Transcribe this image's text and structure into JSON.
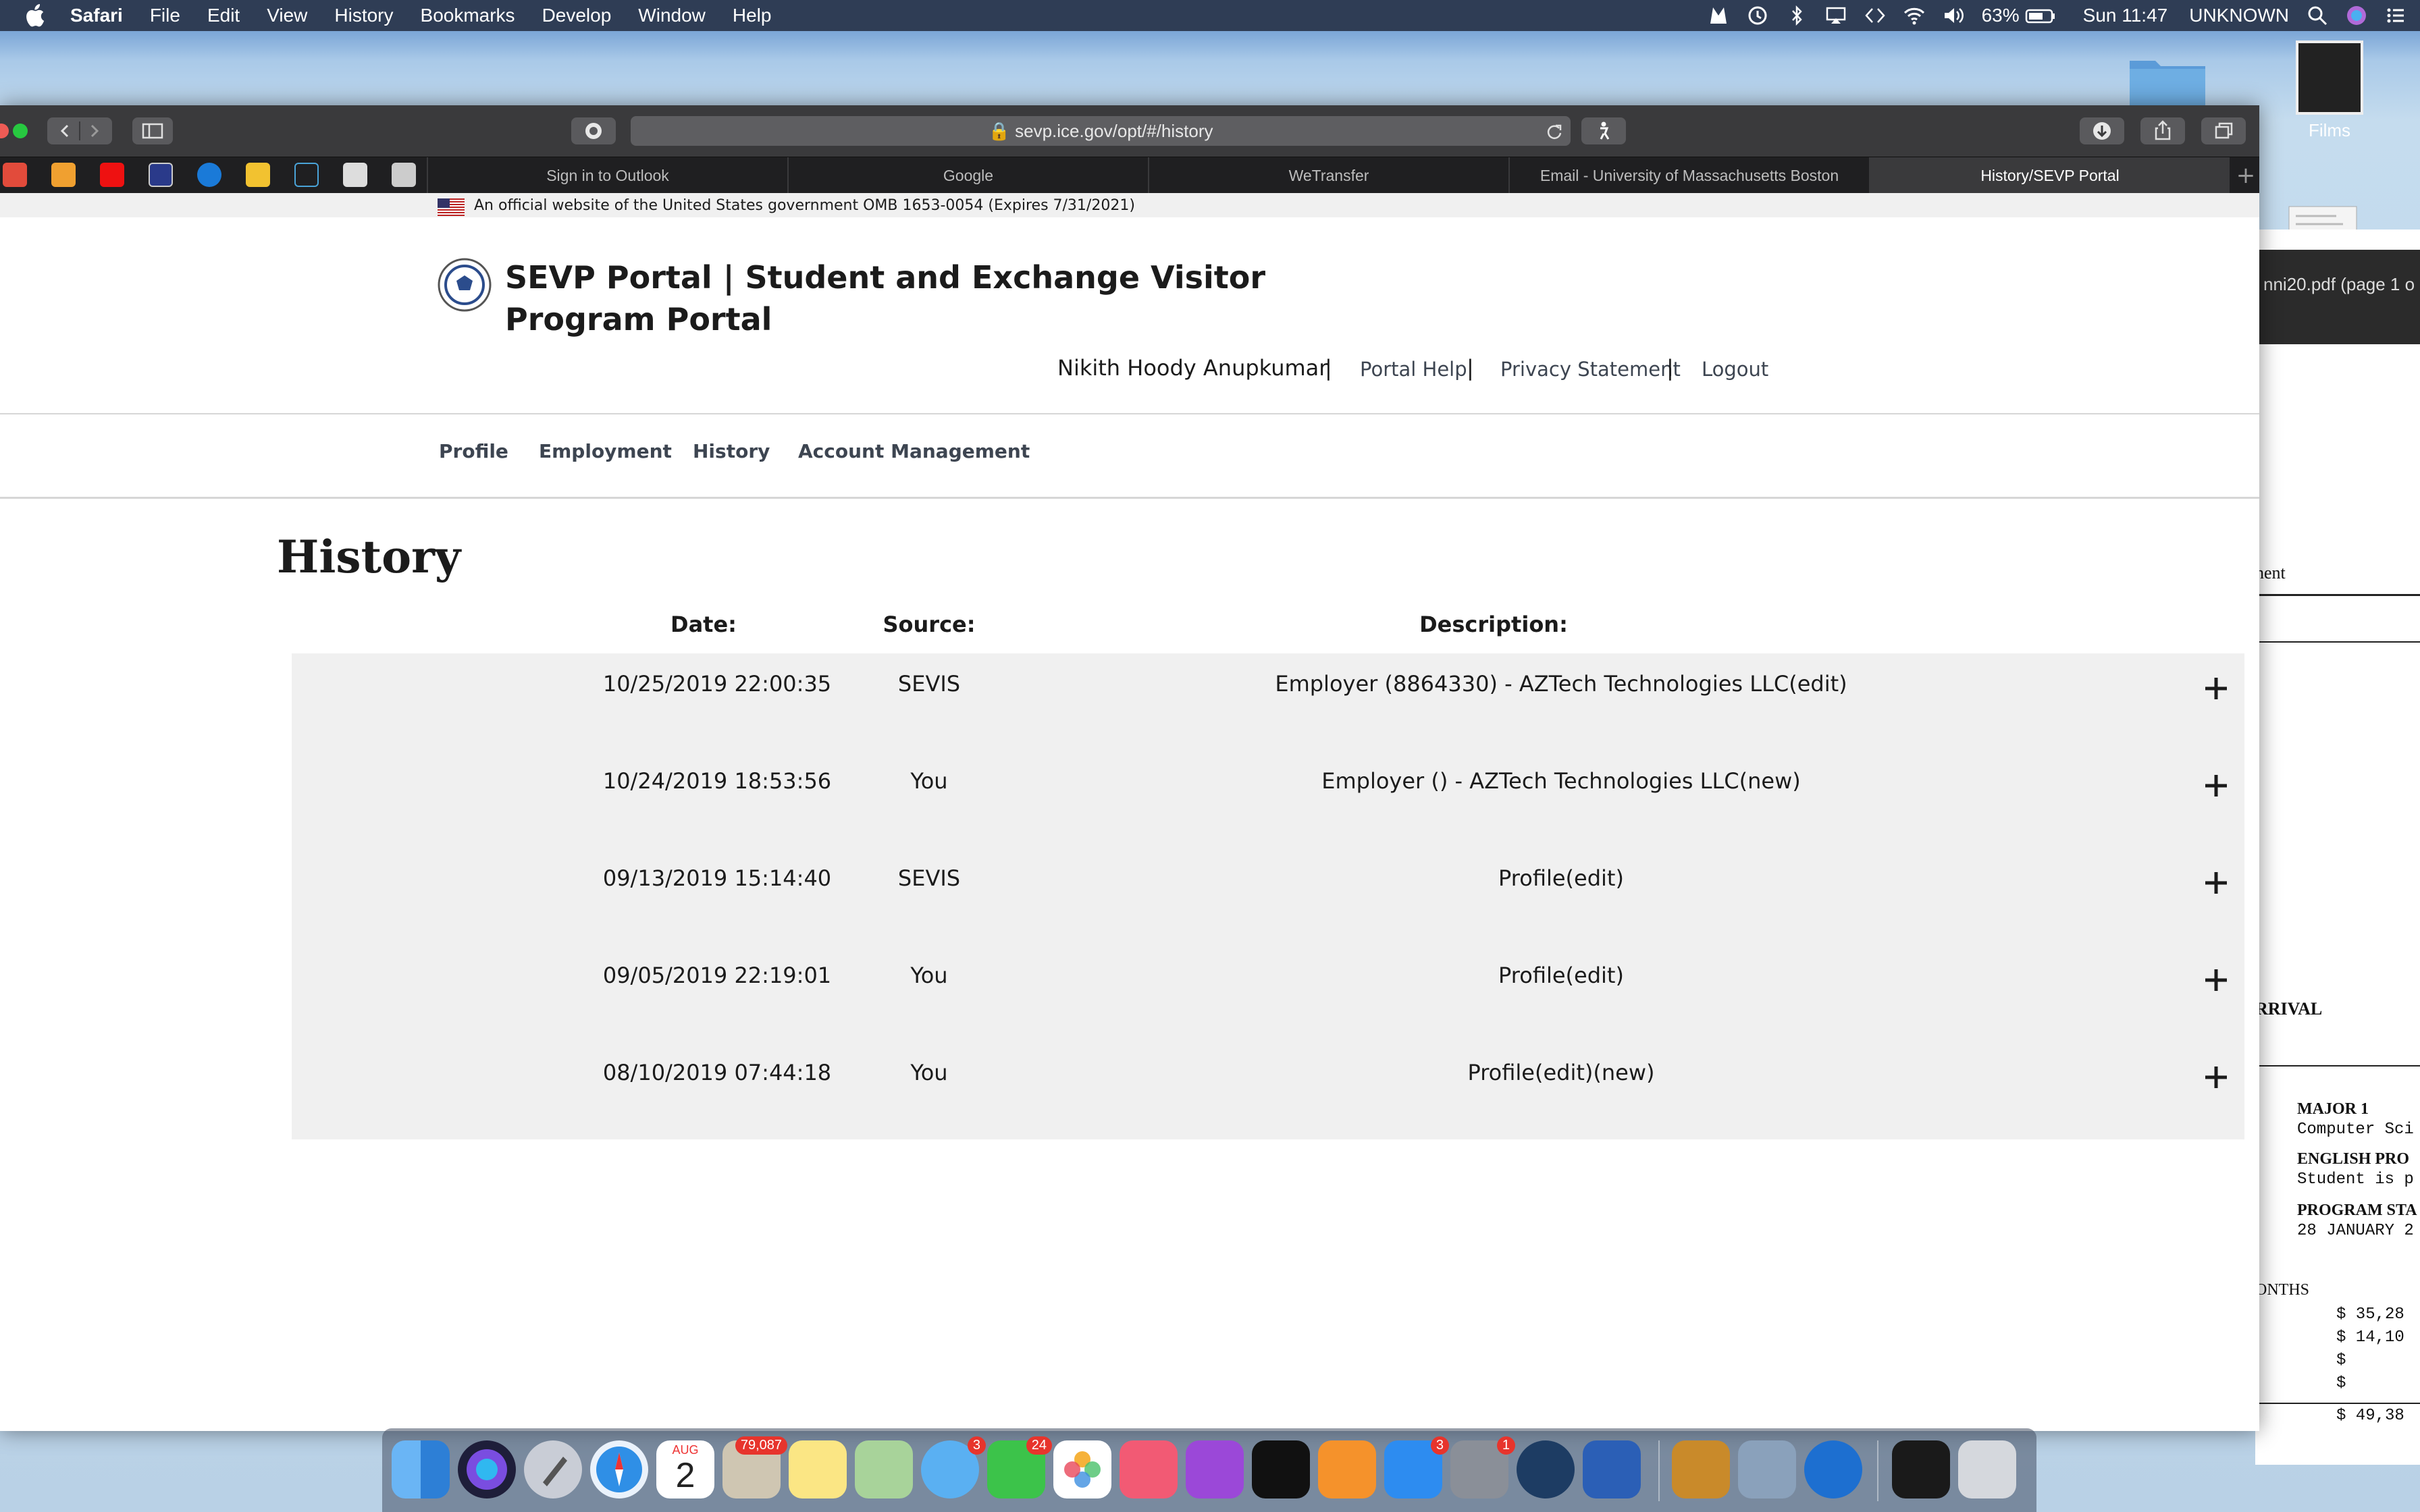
{
  "menubar": {
    "app_name": "Safari",
    "items": [
      "File",
      "Edit",
      "View",
      "History",
      "Bookmarks",
      "Develop",
      "Window",
      "Help"
    ],
    "battery": "63%",
    "clock": "Sun 11:47",
    "user": "UNKNOWN"
  },
  "desktop": {
    "films_label": "Films",
    "pdf_title": "nni20.pdf (page 1 o"
  },
  "pdf_window": {
    "lines": [
      "nent",
      "RRIVAL",
      "MAJOR 1",
      "Computer Sci",
      "ENGLISH PRO",
      "Student is p",
      "PROGRAM STA",
      "28 JANUARY 2",
      "ONTHS",
      "$  35,28",
      "$  14,10",
      "$",
      "$",
      "$  49,38"
    ]
  },
  "browser": {
    "url": "sevp.ice.gov/opt/#/history",
    "tabs": [
      {
        "label": "Sign in to Outlook",
        "active": false
      },
      {
        "label": "Google",
        "active": false
      },
      {
        "label": "WeTransfer",
        "active": false
      },
      {
        "label": "Email - University of Massachusetts Boston",
        "active": false
      },
      {
        "label": "History/SEVP Portal",
        "active": true
      }
    ]
  },
  "banner": {
    "text": "An official website of the United States government OMB 1653-0054 (Expires 7/31/2021)"
  },
  "header": {
    "title": "SEVP Portal | Student and Exchange Visitor Program Portal",
    "user_name": "Nikith Hoody Anupkumar",
    "links": [
      "Portal Help",
      "Privacy Statement",
      "Logout"
    ]
  },
  "nav": {
    "items": [
      "Profile",
      "Employment",
      "History",
      "Account Management"
    ]
  },
  "history": {
    "title": "History",
    "columns": {
      "date": "Date:",
      "source": "Source:",
      "description": "Description:"
    },
    "rows": [
      {
        "date": "10/25/2019 22:00:35",
        "source": "SEVIS",
        "description": "Employer (8864330) - AZTech Technologies LLC(edit)"
      },
      {
        "date": "10/24/2019 18:53:56",
        "source": "You",
        "description": "Employer () - AZTech Technologies LLC(new)"
      },
      {
        "date": "09/13/2019 15:14:40",
        "source": "SEVIS",
        "description": "Profile(edit)"
      },
      {
        "date": "09/05/2019 22:19:01",
        "source": "You",
        "description": "Profile(edit)"
      },
      {
        "date": "08/10/2019 07:44:18",
        "source": "You",
        "description": "Profile(edit)(new)"
      }
    ]
  },
  "dock": {
    "badges": {
      "mail": "79,087",
      "messages": "3",
      "facetime": "24",
      "appstore": "3",
      "preferences": "1"
    },
    "calendar_month": "AUG",
    "calendar_day": "2"
  }
}
